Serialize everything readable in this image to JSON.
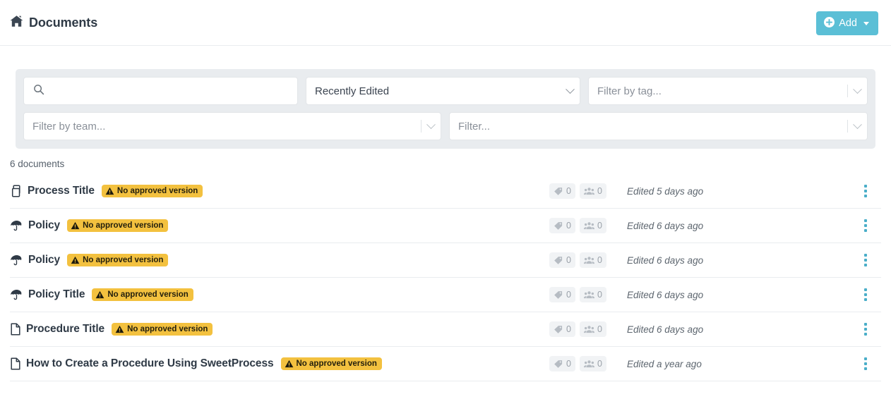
{
  "header": {
    "title": "Documents",
    "home_icon": "home-icon",
    "add_button": {
      "label": "Add",
      "icon": "plus-circle-icon",
      "caret": "caret-down-icon",
      "color": "#5bbfd6"
    }
  },
  "filters": {
    "background_color": "#e9ecef",
    "search": {
      "placeholder": "",
      "value": "",
      "icon": "search-icon"
    },
    "sort": {
      "value": "Recently Edited",
      "icon": "chevron-down-icon"
    },
    "tag": {
      "placeholder": "Filter by tag...",
      "icon": "chevron-down-icon"
    },
    "team": {
      "placeholder": "Filter by team...",
      "icon": "chevron-down-icon"
    },
    "generic": {
      "placeholder": "Filter...",
      "icon": "chevron-down-icon"
    }
  },
  "list": {
    "count_label": "6 documents",
    "badge_color": "#f3c13f",
    "kebab_color": "#4aaec9",
    "documents": [
      {
        "title": "Process Title",
        "type_icon": "process-copy-icon",
        "badge": "No approved version",
        "badge_icon": "warning-triangle-icon",
        "tags": "0",
        "teams": "0",
        "edited": "Edited 5 days ago"
      },
      {
        "title": "Policy",
        "type_icon": "umbrella-icon",
        "badge": "No approved version",
        "badge_icon": "warning-triangle-icon",
        "tags": "0",
        "teams": "0",
        "edited": "Edited 6 days ago"
      },
      {
        "title": "Policy",
        "type_icon": "umbrella-icon",
        "badge": "No approved version",
        "badge_icon": "warning-triangle-icon",
        "tags": "0",
        "teams": "0",
        "edited": "Edited 6 days ago"
      },
      {
        "title": "Policy Title",
        "type_icon": "umbrella-icon",
        "badge": "No approved version",
        "badge_icon": "warning-triangle-icon",
        "tags": "0",
        "teams": "0",
        "edited": "Edited 6 days ago"
      },
      {
        "title": "Procedure Title",
        "type_icon": "file-icon",
        "badge": "No approved version",
        "badge_icon": "warning-triangle-icon",
        "tags": "0",
        "teams": "0",
        "edited": "Edited 6 days ago"
      },
      {
        "title": "How to Create a Procedure Using SweetProcess",
        "type_icon": "file-icon",
        "badge": "No approved version",
        "badge_icon": "warning-triangle-icon",
        "tags": "0",
        "teams": "0",
        "edited": "Edited a year ago"
      }
    ]
  }
}
